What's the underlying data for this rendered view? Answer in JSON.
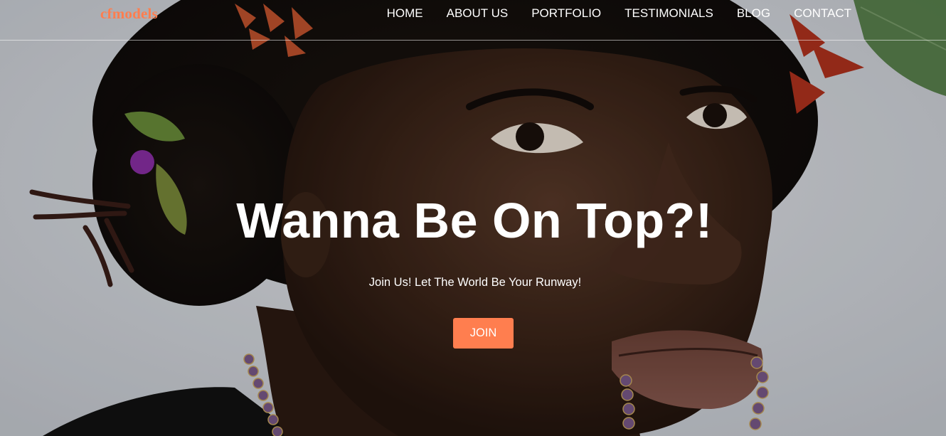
{
  "brand": {
    "name": "cfmodels",
    "color": "#ff7e4f"
  },
  "nav": {
    "items": [
      {
        "label": "HOME"
      },
      {
        "label": "ABOUT US"
      },
      {
        "label": "PORTFOLIO"
      },
      {
        "label": "TESTIMONIALS"
      },
      {
        "label": "BLOG"
      },
      {
        "label": "CONTACT"
      }
    ]
  },
  "hero": {
    "title": "Wanna Be On Top?!",
    "subtitle": "Join Us! Let The World Be Your Runway!",
    "button_label": "JOIN",
    "button_color": "#ff7e4f",
    "background_image": "portrait-photo"
  }
}
